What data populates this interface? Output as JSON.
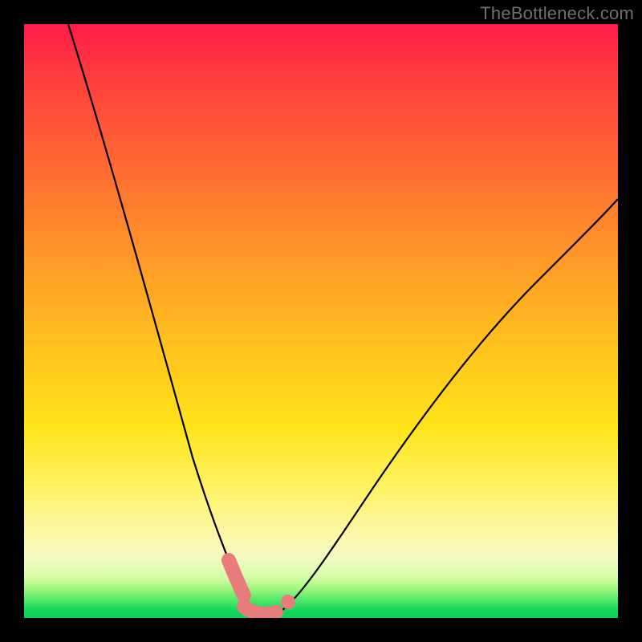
{
  "watermark": "TheBottleneck.com",
  "colors": {
    "frame": "#000000",
    "curve": "#000000",
    "marker": "#e87b7b",
    "gradient_top": "#ff1a48",
    "gradient_bottom": "#0fd058"
  },
  "chart_data": {
    "type": "line",
    "title": "",
    "xlabel": "",
    "ylabel": "",
    "xlim": [
      0,
      100
    ],
    "ylim": [
      0,
      100
    ],
    "series": [
      {
        "name": "bottleneck-curve",
        "x": [
          0,
          5,
          10,
          15,
          20,
          25,
          28,
          30,
          32,
          34,
          36,
          38,
          40,
          45,
          50,
          55,
          60,
          65,
          70,
          75,
          80,
          85,
          90,
          95,
          100
        ],
        "y": [
          100,
          86,
          72,
          58,
          44,
          30,
          20,
          13,
          8,
          4,
          1,
          0,
          1,
          5,
          12,
          20,
          28,
          35,
          42,
          48,
          54,
          59,
          64,
          68,
          72
        ]
      }
    ],
    "markers": [
      {
        "name": "salmon-segment-left",
        "x_range": [
          30,
          34
        ],
        "style": "thick-rounded"
      },
      {
        "name": "salmon-segment-bottom",
        "x_range": [
          34,
          40
        ],
        "style": "thick-rounded"
      },
      {
        "name": "salmon-dot-right",
        "x": 42,
        "style": "dot"
      }
    ],
    "annotations": []
  }
}
